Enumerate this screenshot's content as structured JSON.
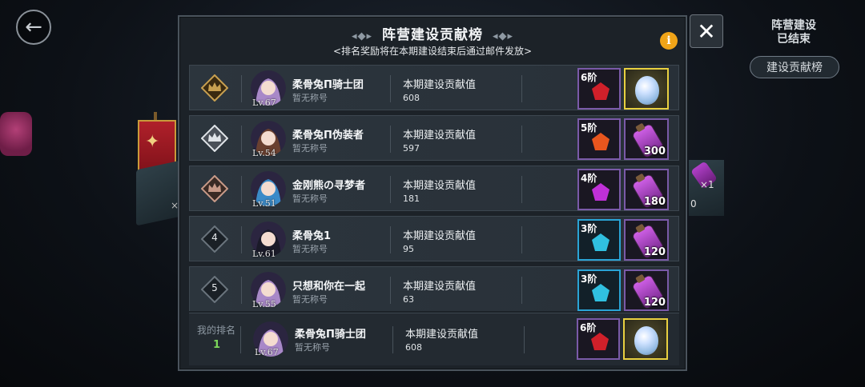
{
  "header": {
    "title": "阵营建设贡献榜",
    "subtitle": "<排名奖励将在本期建设结束后通过邮件发放>",
    "info": "i"
  },
  "right_panel": {
    "status": "阵营建设\n已结束",
    "rank_button": "建设贡献榜"
  },
  "close_label": "✕",
  "back_label": "←",
  "background": {
    "x_mark": "×1",
    "zero": "0",
    "left_mark": "×"
  },
  "rows": [
    {
      "rank": "1",
      "badge": "gold",
      "level": "Lv.67",
      "name": "柔骨兔Π骑士团",
      "title": "暂无称号",
      "contribution_label": "本期建设贡献值",
      "contribution": "608",
      "tier": "6阶",
      "tier_color": "#d0202a",
      "gift": "egg",
      "gift_qty": ""
    },
    {
      "rank": "2",
      "badge": "silver",
      "level": "Lv.54",
      "name": "柔骨兔Π伪装者",
      "title": "暂无称号",
      "contribution_label": "本期建设贡献值",
      "contribution": "597",
      "tier": "5阶",
      "tier_color": "#e8561e",
      "gift": "bottle",
      "gift_qty": "300"
    },
    {
      "rank": "3",
      "badge": "bronze",
      "level": "Lv.51",
      "name": "金刚熊の寻梦者",
      "title": "暂无称号",
      "contribution_label": "本期建设贡献值",
      "contribution": "181",
      "tier": "4阶",
      "tier_color": "#c030d8",
      "gift": "bottle",
      "gift_qty": "180"
    },
    {
      "rank": "4",
      "badge": "plain",
      "level": "Lv.61",
      "name": "柔骨兔1",
      "title": "暂无称号",
      "contribution_label": "本期建设贡献值",
      "contribution": "95",
      "tier": "3阶",
      "tier_color": "#30c0e0",
      "gift": "bottle",
      "gift_qty": "120"
    },
    {
      "rank": "5",
      "badge": "plain",
      "level": "Lv.55",
      "name": "只想和你在一起",
      "title": "暂无称号",
      "contribution_label": "本期建设贡献值",
      "contribution": "63",
      "tier": "3阶",
      "tier_color": "#30c0e0",
      "gift": "bottle",
      "gift_qty": "120"
    }
  ],
  "my_rank": {
    "label": "我的排名",
    "rank": "1",
    "level": "Lv.67",
    "name": "柔骨兔Π骑士团",
    "title": "暂无称号",
    "contribution_label": "本期建设贡献值",
    "contribution": "608",
    "tier": "6阶",
    "tier_color": "#d0202a",
    "gift": "egg"
  },
  "colors": {
    "accent_gold": "#e8d040",
    "info_orange": "#f0a418",
    "my_rank_green": "#7cd65a"
  }
}
